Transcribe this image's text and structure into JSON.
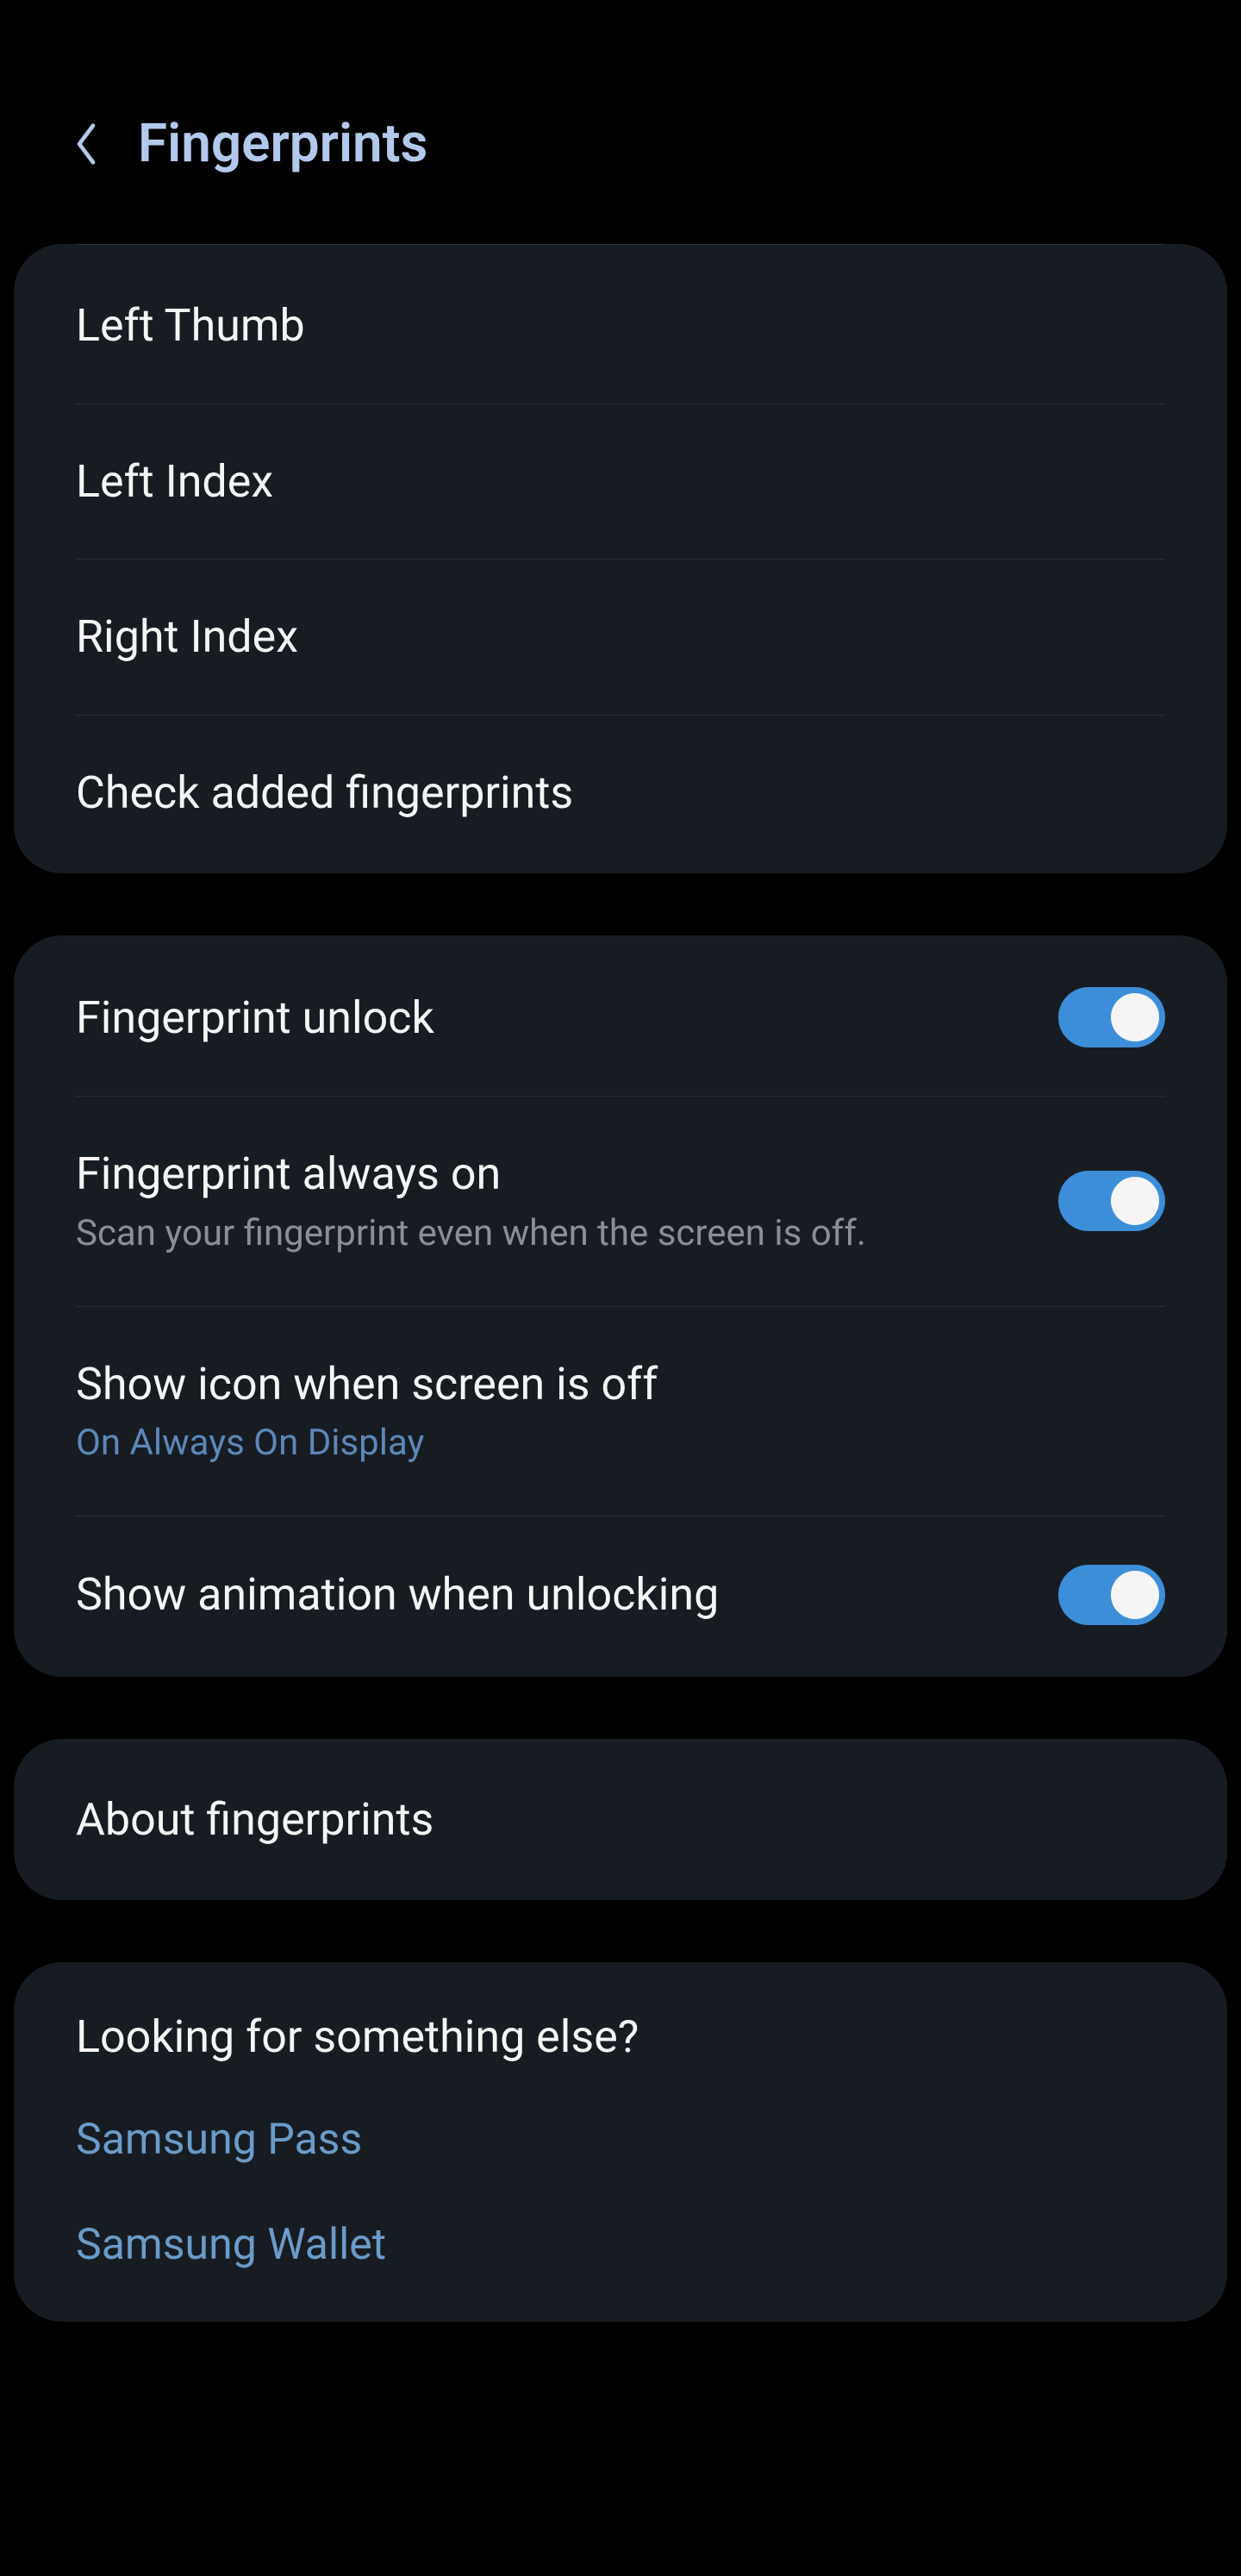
{
  "header": {
    "title": "Fingerprints"
  },
  "fingerprints": [
    {
      "label": "Left Thumb"
    },
    {
      "label": "Left Index"
    },
    {
      "label": "Right Index"
    }
  ],
  "check_label": "Check added fingerprints",
  "settings": {
    "unlock": {
      "title": "Fingerprint unlock"
    },
    "always_on": {
      "title": "Fingerprint always on",
      "subtitle": "Scan your fingerprint even when the screen is off."
    },
    "show_icon": {
      "title": "Show icon when screen is off",
      "value": "On Always On Display"
    },
    "animation": {
      "title": "Show animation when unlocking"
    }
  },
  "about": {
    "title": "About fingerprints"
  },
  "more": {
    "heading": "Looking for something else?",
    "links": [
      {
        "label": "Samsung Pass"
      },
      {
        "label": "Samsung Wallet"
      }
    ]
  }
}
